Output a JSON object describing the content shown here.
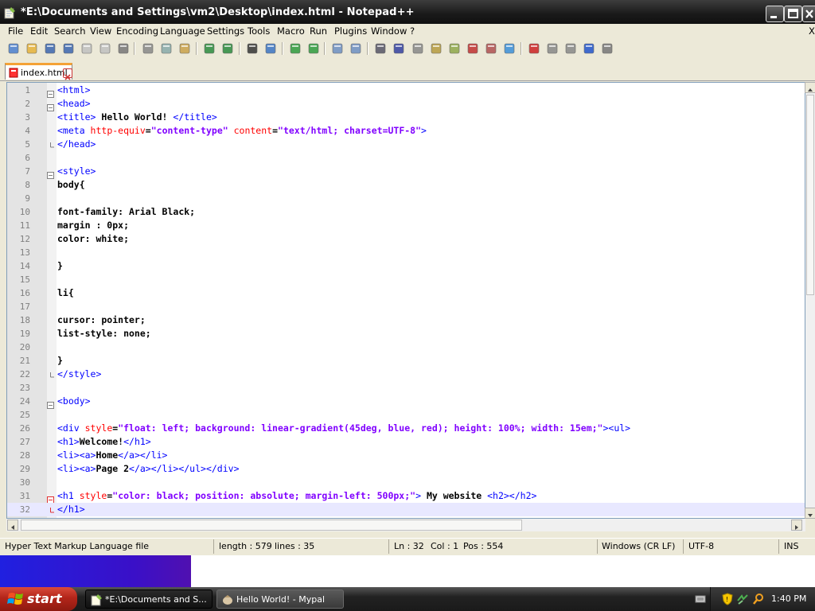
{
  "window": {
    "title": "*E:\\Documents and Settings\\vm2\\Desktop\\index.html - Notepad++"
  },
  "menu": [
    "File",
    "Edit",
    "Search",
    "View",
    "Encoding",
    "Language",
    "Settings",
    "Tools",
    "Macro",
    "Run",
    "Plugins",
    "Window",
    "?"
  ],
  "menu_close": "X",
  "toolbar_icons": [
    "new-file-icon",
    "open-file-icon",
    "save-icon",
    "save-all-icon",
    "close-icon",
    "close-all-icon",
    "print-icon",
    "cut-icon",
    "copy-icon",
    "paste-icon",
    "undo-icon",
    "redo-icon",
    "find-icon",
    "replace-icon",
    "zoom-in-icon",
    "zoom-out-icon",
    "sync-v-icon",
    "sync-h-icon",
    "word-wrap-icon",
    "show-all-chars-icon",
    "indent-guide-icon",
    "user-lang-icon",
    "doc-map-icon",
    "function-list-icon",
    "folder-workspace-icon",
    "monitoring-icon",
    "record-macro-icon",
    "stop-record-icon",
    "play-macro-icon",
    "run-macro-multiple-icon",
    "save-macro-icon"
  ],
  "tab": {
    "label": "index.html"
  },
  "editor": {
    "current_line": 32,
    "lines": [
      {
        "n": "1",
        "fold": "open",
        "parts": [
          [
            "t",
            "<html>"
          ]
        ]
      },
      {
        "n": "2",
        "fold": "open",
        "parts": [
          [
            "t",
            "<head>"
          ]
        ]
      },
      {
        "n": "3",
        "fold": "",
        "parts": [
          [
            "t",
            "<title>"
          ],
          [
            "x",
            " Hello World! "
          ],
          [
            "t",
            "</title>"
          ]
        ]
      },
      {
        "n": "4",
        "fold": "",
        "parts": [
          [
            "t",
            "<meta "
          ],
          [
            "a",
            "http-equiv"
          ],
          [
            "x",
            "="
          ],
          [
            "s",
            "\"content-type\""
          ],
          [
            "x",
            " "
          ],
          [
            "a",
            "content"
          ],
          [
            "x",
            "="
          ],
          [
            "s",
            "\"text/html; charset=UTF-8\""
          ],
          [
            "t",
            ">"
          ]
        ]
      },
      {
        "n": "5",
        "fold": "end",
        "parts": [
          [
            "t",
            "</head>"
          ]
        ]
      },
      {
        "n": "6",
        "fold": "",
        "parts": []
      },
      {
        "n": "7",
        "fold": "open",
        "parts": [
          [
            "t",
            "<style>"
          ]
        ]
      },
      {
        "n": "8",
        "fold": "",
        "parts": [
          [
            "x",
            "body{"
          ]
        ]
      },
      {
        "n": "9",
        "fold": "",
        "parts": []
      },
      {
        "n": "10",
        "fold": "",
        "parts": [
          [
            "x",
            "font-family: Arial Black;"
          ]
        ]
      },
      {
        "n": "11",
        "fold": "",
        "parts": [
          [
            "x",
            "margin : 0px;"
          ]
        ]
      },
      {
        "n": "12",
        "fold": "",
        "parts": [
          [
            "x",
            "color: white;"
          ]
        ]
      },
      {
        "n": "13",
        "fold": "",
        "parts": []
      },
      {
        "n": "14",
        "fold": "",
        "parts": [
          [
            "x",
            "}"
          ]
        ]
      },
      {
        "n": "15",
        "fold": "",
        "parts": []
      },
      {
        "n": "16",
        "fold": "",
        "parts": [
          [
            "x",
            "li{"
          ]
        ]
      },
      {
        "n": "17",
        "fold": "",
        "parts": []
      },
      {
        "n": "18",
        "fold": "",
        "parts": [
          [
            "x",
            "cursor: pointer;"
          ]
        ]
      },
      {
        "n": "19",
        "fold": "",
        "parts": [
          [
            "x",
            "list-style: none;"
          ]
        ]
      },
      {
        "n": "20",
        "fold": "",
        "parts": []
      },
      {
        "n": "21",
        "fold": "",
        "parts": [
          [
            "x",
            "}"
          ]
        ]
      },
      {
        "n": "22",
        "fold": "end",
        "parts": [
          [
            "t",
            "</style>"
          ]
        ]
      },
      {
        "n": "23",
        "fold": "",
        "parts": []
      },
      {
        "n": "24",
        "fold": "open",
        "parts": [
          [
            "t",
            "<body>"
          ]
        ]
      },
      {
        "n": "25",
        "fold": "",
        "parts": []
      },
      {
        "n": "26",
        "fold": "",
        "parts": [
          [
            "t",
            "<div "
          ],
          [
            "a",
            "style"
          ],
          [
            "x",
            "="
          ],
          [
            "s",
            "\"float: left; background: linear-gradient(45deg, blue, red); height: 100%; width: 15em;\""
          ],
          [
            "t",
            "><ul>"
          ]
        ]
      },
      {
        "n": "27",
        "fold": "",
        "parts": [
          [
            "t",
            "<h1>"
          ],
          [
            "x",
            "Welcome!"
          ],
          [
            "t",
            "</h1>"
          ]
        ]
      },
      {
        "n": "28",
        "fold": "",
        "parts": [
          [
            "t",
            "<li><a>"
          ],
          [
            "x",
            "Home"
          ],
          [
            "t",
            "</a></li>"
          ]
        ]
      },
      {
        "n": "29",
        "fold": "",
        "parts": [
          [
            "t",
            "<li><a>"
          ],
          [
            "x",
            "Page 2"
          ],
          [
            "t",
            "</a></li></ul></div>"
          ]
        ]
      },
      {
        "n": "30",
        "fold": "",
        "parts": []
      },
      {
        "n": "31",
        "fold": "open-red",
        "parts": [
          [
            "t",
            "<h1 "
          ],
          [
            "a",
            "style"
          ],
          [
            "x",
            "="
          ],
          [
            "s",
            "\"color: black; position: absolute; margin-left: 500px;\""
          ],
          [
            "t",
            ">"
          ],
          [
            "x",
            " My website "
          ],
          [
            "t",
            "<h2></h2>"
          ]
        ]
      },
      {
        "n": "32",
        "fold": "end-red",
        "parts": [
          [
            "t",
            "</h1>"
          ]
        ]
      }
    ]
  },
  "status": {
    "file_type": "Hyper Text Markup Language file",
    "length": "length : 579",
    "lines": "lines : 35",
    "ln": "Ln : 32",
    "col": "Col : 1",
    "pos": "Pos : 554",
    "eol": "Windows (CR LF)",
    "encoding": "UTF-8",
    "mode": "INS"
  },
  "taskbar": {
    "start_label": "start",
    "tasks": [
      {
        "label": "*E:\\Documents and S...",
        "active": true
      },
      {
        "label": "Hello World! - Mypal",
        "active": false
      }
    ],
    "clock": "1:40 PM"
  }
}
